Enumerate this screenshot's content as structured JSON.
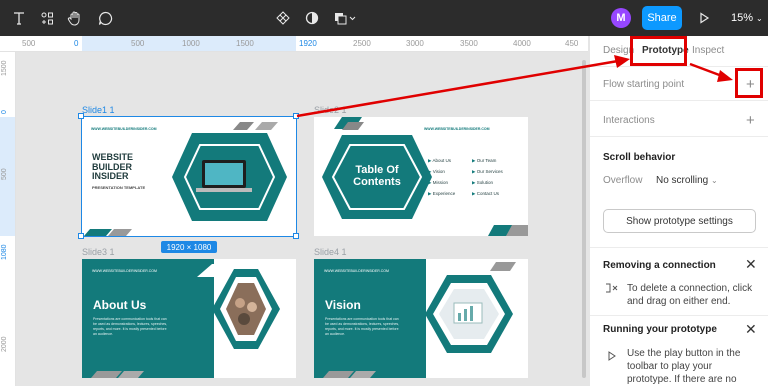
{
  "toolbar": {
    "icons": [
      "text-icon",
      "components-icon",
      "hand-icon",
      "comment-icon",
      "component-center-icon",
      "contrast-icon",
      "layers-icon"
    ],
    "avatar_letter": "M",
    "share_label": "Share",
    "zoom": "15%"
  },
  "ruler": {
    "top": [
      "500",
      "0",
      "500",
      "1000",
      "1500",
      "1920",
      "2500",
      "3000",
      "3500",
      "4000",
      "450"
    ],
    "left": [
      "1500",
      "0",
      "500",
      "1080",
      "2000"
    ]
  },
  "frames": [
    {
      "label": "Slide1 1",
      "title": "WEBSITE BUILDER INSIDER",
      "subtitle": "PRESENTATION TEMPLATE",
      "url": "WWW.WEBSITEBUILDERINSIDER.COM"
    },
    {
      "label": "Slide2 1",
      "title": "Table Of Contents",
      "items": [
        "About Us",
        "Vision",
        "Mission",
        "Experience",
        "Our Team",
        "Our Services",
        "Solution",
        "Contact Us"
      ],
      "url": "WWW.WEBSITEBUILDERINSIDER.COM"
    },
    {
      "label": "Slide3 1",
      "title": "About Us",
      "body": "Presentations are communication tools that can be used as demonstrations, lectures, speeches, reports, and more. It is mostly presented before an audience.",
      "url": "WWW.WEBSITEBUILDERINSIDER.COM"
    },
    {
      "label": "Slide4 1",
      "title": "Vision",
      "body": "Presentations are communication tools that can be used as demonstrations, lectures, speeches, reports, and more. It is mostly presented before an audience.",
      "url": "WWW.WEBSITEBUILDERINSIDER.COM"
    }
  ],
  "selection_size": "1920 × 1080",
  "panel": {
    "tabs": [
      "Design",
      "Prototype",
      "Inspect"
    ],
    "flow_starting_point": "Flow starting point",
    "interactions": "Interactions",
    "scroll_behavior": "Scroll behavior",
    "overflow_label": "Overflow",
    "overflow_value": "No scrolling",
    "show_settings": "Show prototype settings",
    "tip1_title": "Removing a connection",
    "tip1_text": "To delete a connection, click and drag on either end.",
    "tip2_title": "Running your prototype",
    "tip2_text": "Use the play button in the toolbar to play your prototype. If there are no connections, the"
  },
  "colors": {
    "accent": "#0d99ff",
    "teal": "#137a7b",
    "selection": "#1e88e5",
    "highlight": "#e00000"
  }
}
